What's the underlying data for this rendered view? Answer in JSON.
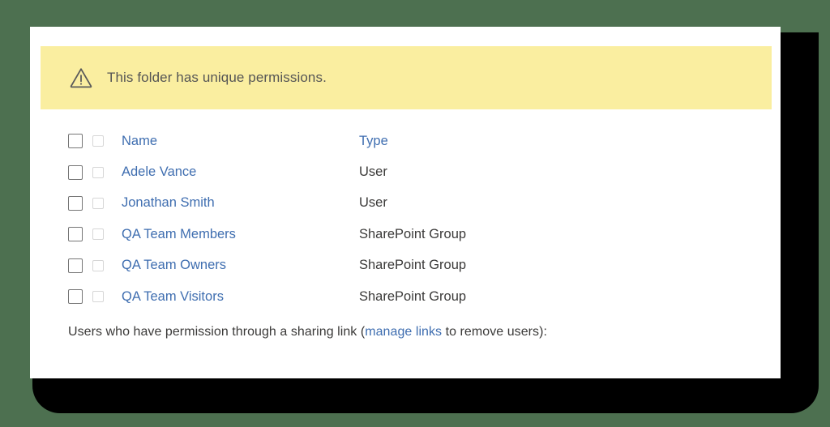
{
  "colors": {
    "page_background": "#4d7050",
    "card_background": "#ffffff",
    "banner_background": "#faeea0",
    "link_blue": "#3f6eb0",
    "text_gray": "#3b3a39",
    "banner_text_gray": "#555555",
    "shadow": "#000000"
  },
  "banner": {
    "icon": "warning-triangle-icon",
    "message": "This folder has unique permissions."
  },
  "table": {
    "columns": [
      "Name",
      "Type"
    ],
    "header": {
      "name": "Name",
      "type": "Type"
    },
    "rows": [
      {
        "name": "Adele Vance",
        "type": "User"
      },
      {
        "name": "Jonathan Smith",
        "type": "User"
      },
      {
        "name": "QA Team Members",
        "type": "SharePoint Group"
      },
      {
        "name": "QA Team Owners",
        "type": "SharePoint Group"
      },
      {
        "name": "QA Team Visitors",
        "type": "SharePoint Group"
      }
    ]
  },
  "footer": {
    "text_before": "Users who have permission through a sharing link (",
    "link_label": "manage links",
    "text_after": " to remove users):"
  }
}
